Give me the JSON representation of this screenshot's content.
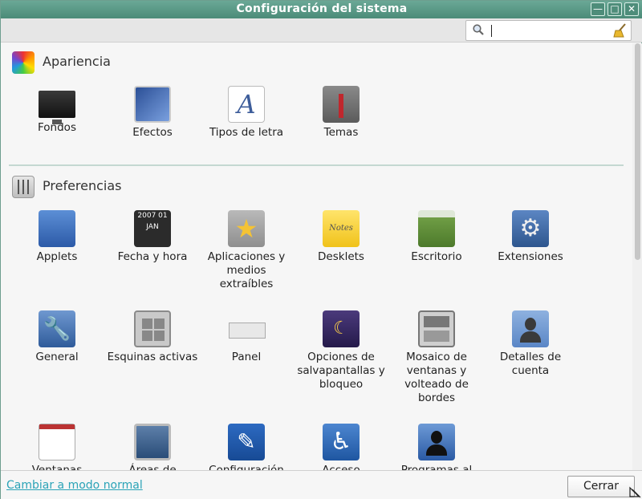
{
  "window": {
    "title": "Configuración del sistema",
    "buttons": {
      "minimize": "—",
      "maximize": "□",
      "close": "✕"
    }
  },
  "search": {
    "value": "",
    "placeholder": ""
  },
  "sections": [
    {
      "title": "Apariencia",
      "icon": "appearance-icon",
      "items": [
        {
          "label": "Fondos",
          "icon": "backgrounds-icon"
        },
        {
          "label": "Efectos",
          "icon": "effects-icon"
        },
        {
          "label": "Tipos de letra",
          "icon": "fonts-icon",
          "glyph": "A"
        },
        {
          "label": "Temas",
          "icon": "themes-icon"
        }
      ]
    },
    {
      "title": "Preferencias",
      "icon": "preferences-icon",
      "items": [
        {
          "label": "Applets",
          "icon": "applets-icon"
        },
        {
          "label": "Fecha y hora",
          "icon": "date-time-icon",
          "glyph": "2007 01 JAN"
        },
        {
          "label": "Aplicaciones y medios extraíbles",
          "icon": "removable-media-icon",
          "glyph": "★"
        },
        {
          "label": "Desklets",
          "icon": "desklets-icon",
          "glyph": "Notes"
        },
        {
          "label": "Escritorio",
          "icon": "desktop-icon"
        },
        {
          "label": "Extensiones",
          "icon": "extensions-icon",
          "glyph": "⚙"
        },
        {
          "label": "General",
          "icon": "general-icon",
          "glyph": "🔧"
        },
        {
          "label": "Esquinas activas",
          "icon": "hot-corners-icon"
        },
        {
          "label": "Panel",
          "icon": "panel-icon"
        },
        {
          "label": "Opciones de salvapantallas y bloqueo",
          "icon": "screensaver-icon",
          "glyph": "☾"
        },
        {
          "label": "Mosaico de ventanas y volteado de bordes",
          "icon": "window-tiling-icon"
        },
        {
          "label": "Detalles de cuenta",
          "icon": "account-details-icon"
        },
        {
          "label": "Ventanas",
          "icon": "windows-icon"
        },
        {
          "label": "Áreas de",
          "icon": "workspaces-icon"
        },
        {
          "label": "Configuración",
          "icon": "language-icon",
          "glyph": "✎"
        },
        {
          "label": "Acceso",
          "icon": "accessibility-icon",
          "glyph": "♿"
        },
        {
          "label": "Programas al",
          "icon": "startup-programs-icon"
        }
      ]
    }
  ],
  "footer": {
    "mode_link": "Cambiar a modo normal",
    "close_button": "Cerrar"
  }
}
